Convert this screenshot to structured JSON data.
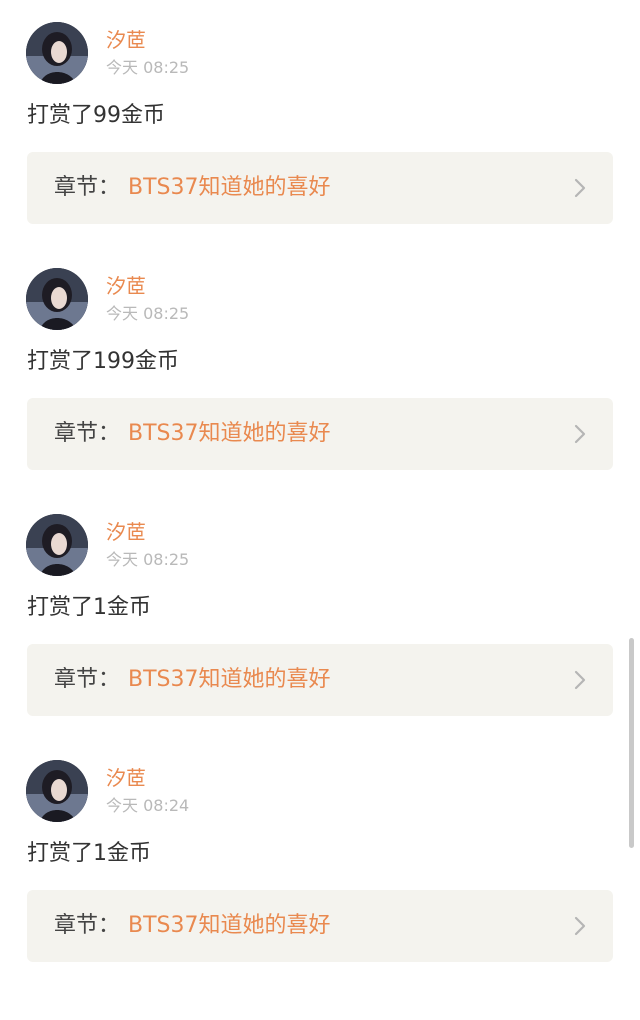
{
  "colors": {
    "accent": "#e9894f",
    "timestamp": "#b9b9b9",
    "chapter_bg": "#f4f3ee",
    "separator": "#f7f6f4"
  },
  "items": [
    {
      "username": "汐茝",
      "time": "今天 08:25",
      "reward": "打赏了99金币",
      "chapter_prefix": "章节：",
      "chapter_title": "BTS37知道她的喜好",
      "chevron_icon": "chevron-right-icon"
    },
    {
      "username": "汐茝",
      "time": "今天 08:25",
      "reward": "打赏了199金币",
      "chapter_prefix": "章节：",
      "chapter_title": "BTS37知道她的喜好",
      "chevron_icon": "chevron-right-icon"
    },
    {
      "username": "汐茝",
      "time": "今天 08:25",
      "reward": "打赏了1金币",
      "chapter_prefix": "章节：",
      "chapter_title": "BTS37知道她的喜好",
      "chevron_icon": "chevron-right-icon"
    },
    {
      "username": "汐茝",
      "time": "今天 08:24",
      "reward": "打赏了1金币",
      "chapter_prefix": "章节：",
      "chapter_title": "BTS37知道她的喜好",
      "chevron_icon": "chevron-right-icon"
    }
  ]
}
